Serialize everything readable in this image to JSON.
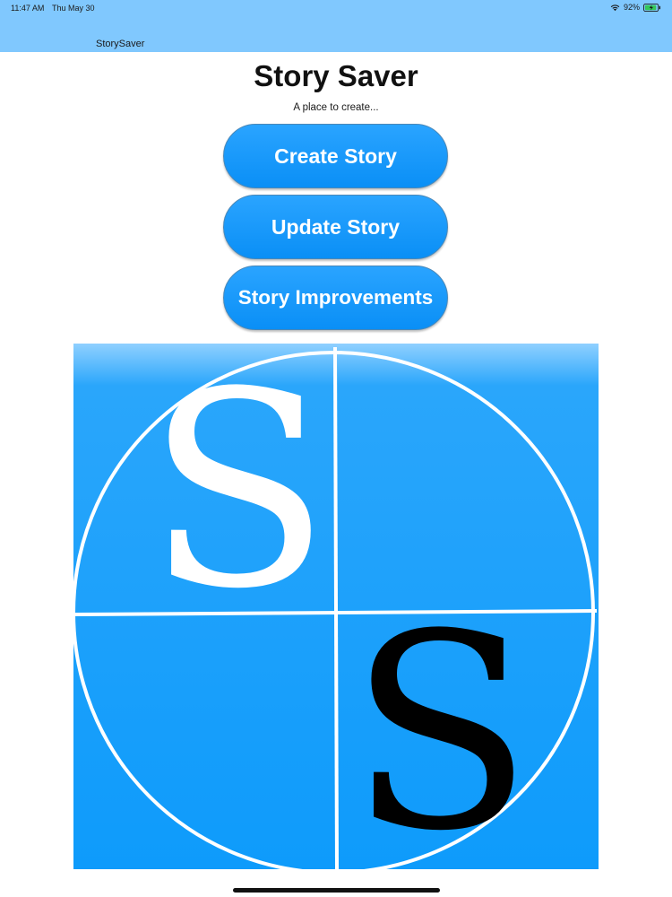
{
  "status_bar": {
    "time": "11:47 AM",
    "date": "Thu May 30",
    "battery_percent": "92%",
    "battery_level": 0.92,
    "icons": [
      "wifi-icon",
      "battery-charging-icon"
    ]
  },
  "nav": {
    "title": "StorySaver"
  },
  "main": {
    "title": "Story Saver",
    "subtitle": "A place to create...",
    "buttons": {
      "create": "Create Story",
      "update": "Update Story",
      "improvements": "Story Improvements"
    }
  },
  "logo": {
    "letter_top_left": "S",
    "letter_bottom_right": "S"
  },
  "colors": {
    "status_bar_bg": "#80c8fe",
    "accent": "#0a8ff6",
    "button_text": "#ffffff",
    "logo_bg": "#1ea2fb",
    "logo_letter_light": "#ffffff",
    "logo_letter_dark": "#000000"
  }
}
